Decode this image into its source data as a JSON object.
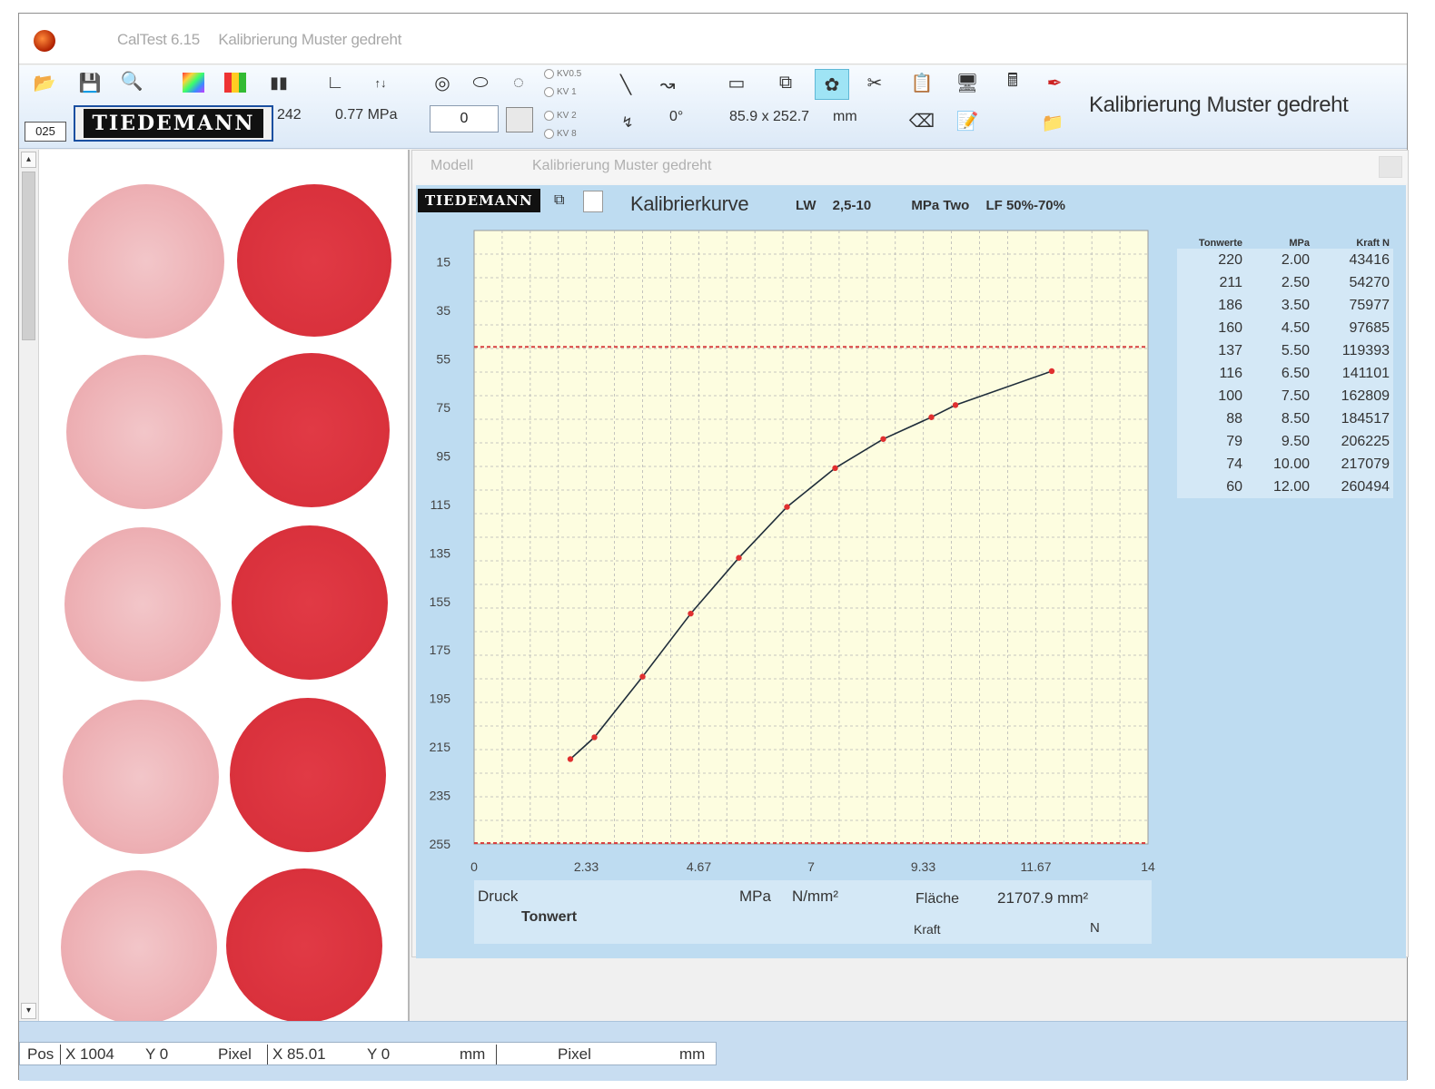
{
  "window": {
    "title_app": "CalTest 6.15",
    "title_doc": "Kalibrierung Muster gedreht"
  },
  "toolbar": {
    "counter": "025",
    "brand": "TIEDEMANN",
    "value_242": "242",
    "pressure": "0.77 MPa",
    "number_input": "0",
    "radio_options": [
      "KV0.5",
      "KV 1",
      "KV 2",
      "KV 8"
    ],
    "angle": "0°",
    "dimensions": "85.9 x 252.7",
    "dimensions_unit": "mm",
    "heading": "Kalibrierung Muster gedreht",
    "icons": [
      "open-folder-icon",
      "save-icon",
      "search-icon",
      "color-palette-icon",
      "color-bars-icon",
      "histogram-icon",
      "curve-icon",
      "numbers-icon",
      "spiral-icon",
      "ellipses-icon",
      "dotted-circle-icon",
      "line-icon",
      "graph-icon",
      "rectangle-icon",
      "copy-window-icon",
      "puzzle-icon",
      "scissors-icon",
      "paste-icon",
      "monitor-icon",
      "calculator-icon",
      "pen-icon",
      "eraser-icon",
      "edit-document-icon",
      "folder-image-icon"
    ]
  },
  "thumbnails": {
    "rows": 5,
    "left_column": "light",
    "right_column": "dark"
  },
  "chart_window": {
    "tab_label": "Modell",
    "tab_title": "Kalibrierung Muster gedreht",
    "brand": "TIEDEMANN",
    "copy_icon": "copy-icon",
    "title": "Kalibrierkurve",
    "params": [
      "LW",
      "2,5-10",
      "MPa Two",
      "LF 50%-70%"
    ],
    "table_headers": [
      "Tonwerte",
      "MPa",
      "Kraft N"
    ],
    "table_rows": [
      [
        "220",
        "2.00",
        "43416"
      ],
      [
        "211",
        "2.50",
        "54270"
      ],
      [
        "186",
        "3.50",
        "75977"
      ],
      [
        "160",
        "4.50",
        "97685"
      ],
      [
        "137",
        "5.50",
        "119393"
      ],
      [
        "116",
        "6.50",
        "141101"
      ],
      [
        "100",
        "7.50",
        "162809"
      ],
      [
        "88",
        "8.50",
        "184517"
      ],
      [
        "79",
        "9.50",
        "206225"
      ],
      [
        "74",
        "10.00",
        "217079"
      ],
      [
        "60",
        "12.00",
        "260494"
      ]
    ],
    "footer": {
      "druck": "Druck",
      "tonwert": "Tonwert",
      "mpa": "MPa",
      "nmm": "N/mm²",
      "flaeche_label": "Fläche",
      "flaeche_value": "21707.9 mm²",
      "kraft_label": "Kraft",
      "kraft_unit": "N"
    }
  },
  "chart_data": {
    "type": "line",
    "x_ticks": [
      "0",
      "2.33",
      "4.67",
      "7",
      "9.33",
      "11.67",
      "14"
    ],
    "y_ticks": [
      "15",
      "35",
      "55",
      "75",
      "95",
      "115",
      "135",
      "155",
      "175",
      "195",
      "215",
      "235",
      "255"
    ],
    "xlim": [
      0,
      14
    ],
    "ylim": [
      0,
      255
    ],
    "y_inverted": true,
    "grid": true,
    "reference_lines_y": [
      50,
      255
    ],
    "series": [
      {
        "x": [
          2.0,
          2.5,
          3.5,
          4.5,
          5.5,
          6.5,
          7.5,
          8.5,
          9.5,
          10.0,
          12.0
        ],
        "y": [
          220,
          211,
          186,
          160,
          137,
          116,
          100,
          88,
          79,
          74,
          60
        ]
      }
    ],
    "colors": {
      "plot_bg": "#fdfde0",
      "line": "#1f2d3a",
      "points": "#e03030",
      "grid": "#b6b6b6",
      "reference": "#d84040"
    }
  },
  "statusbar": {
    "pos_label": "Pos",
    "x_pixel": "X 1004",
    "y_pixel": "Y 0",
    "pixel_label": "Pixel",
    "x_mm": "X 85.01",
    "y_mm": "Y 0",
    "mm_label": "mm",
    "pixel_label2": "Pixel",
    "mm_label2": "mm"
  }
}
